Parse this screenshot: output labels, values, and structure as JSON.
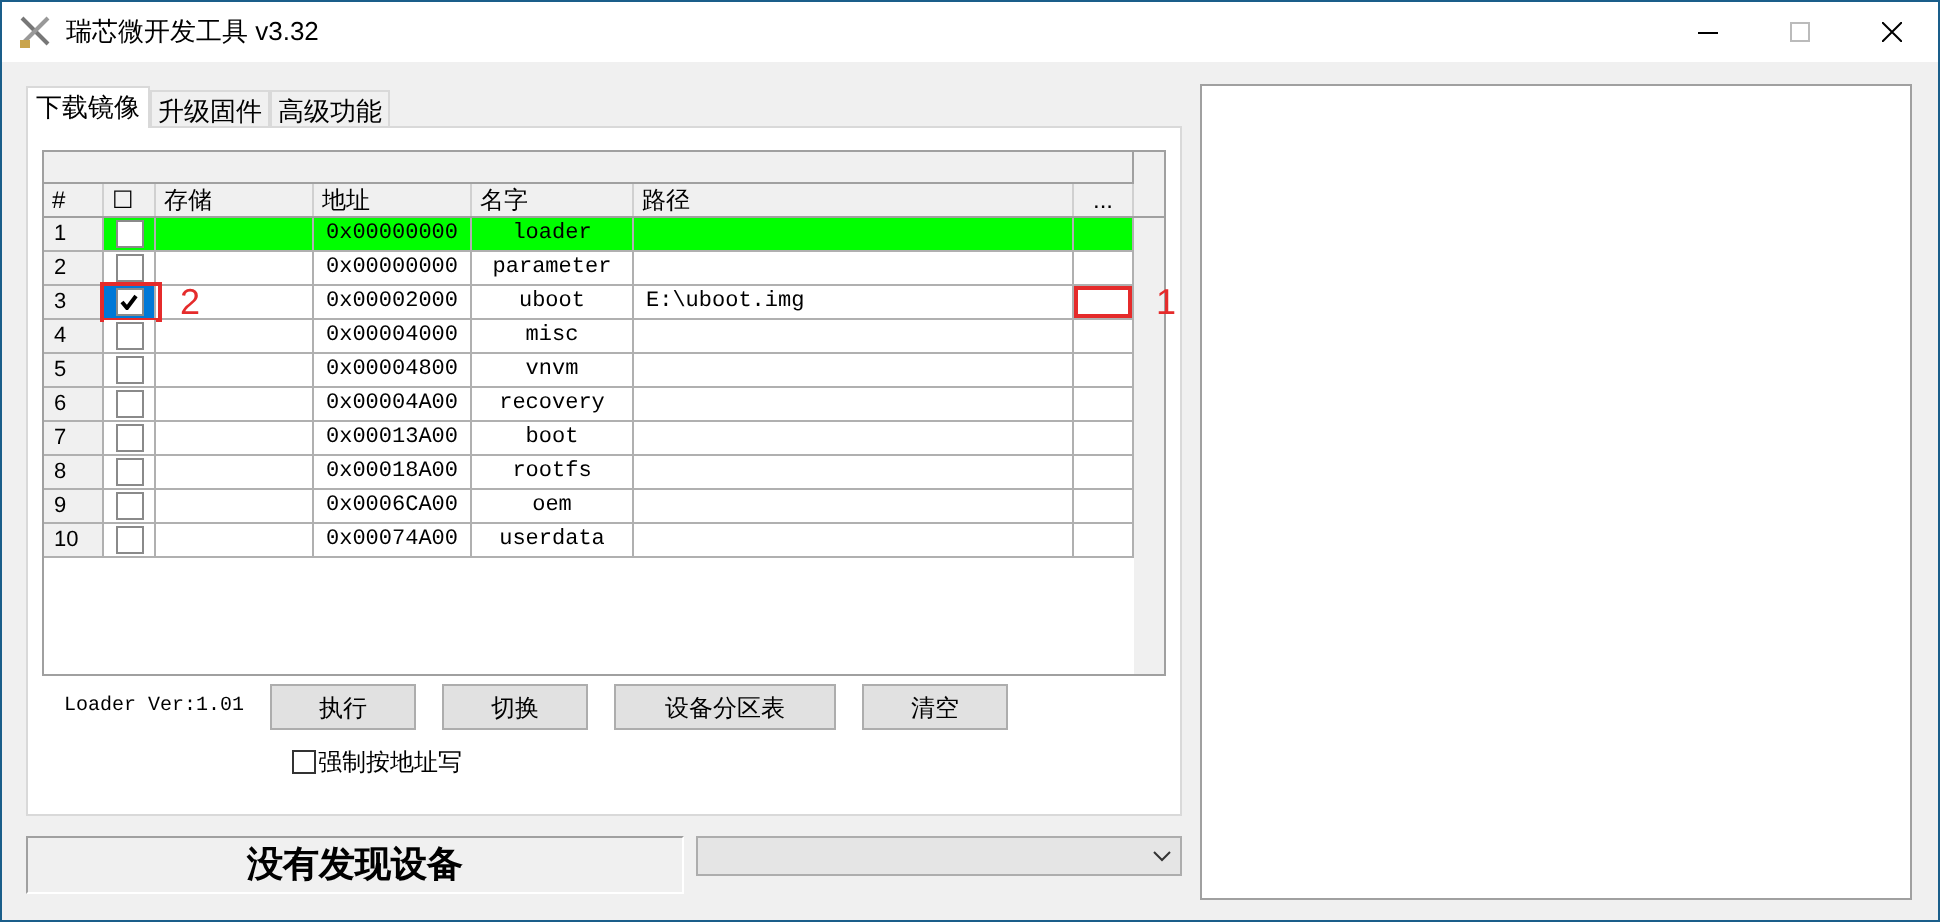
{
  "window": {
    "title": "瑞芯微开发工具 v3.32"
  },
  "tabs": [
    {
      "label": "下载镜像",
      "selected": true
    },
    {
      "label": "升级固件",
      "selected": false
    },
    {
      "label": "高级功能",
      "selected": false
    }
  ],
  "table": {
    "columns": [
      "#",
      "☐",
      "存储",
      "地址",
      "名字",
      "路径",
      "..."
    ],
    "rows": [
      {
        "index": "1",
        "checked": false,
        "selected": false,
        "highlighted": true,
        "address": "0x00000000",
        "name": "loader",
        "path": ""
      },
      {
        "index": "2",
        "checked": false,
        "selected": false,
        "highlighted": false,
        "address": "0x00000000",
        "name": "parameter",
        "path": ""
      },
      {
        "index": "3",
        "checked": true,
        "selected": true,
        "highlighted": false,
        "address": "0x00002000",
        "name": "uboot",
        "path": "E:\\uboot.img",
        "check_marker": "2",
        "browse_marker": "1"
      },
      {
        "index": "4",
        "checked": false,
        "selected": false,
        "highlighted": false,
        "address": "0x00004000",
        "name": "misc",
        "path": ""
      },
      {
        "index": "5",
        "checked": false,
        "selected": false,
        "highlighted": false,
        "address": "0x00004800",
        "name": "vnvm",
        "path": ""
      },
      {
        "index": "6",
        "checked": false,
        "selected": false,
        "highlighted": false,
        "address": "0x00004A00",
        "name": "recovery",
        "path": ""
      },
      {
        "index": "7",
        "checked": false,
        "selected": false,
        "highlighted": false,
        "address": "0x00013A00",
        "name": "boot",
        "path": ""
      },
      {
        "index": "8",
        "checked": false,
        "selected": false,
        "highlighted": false,
        "address": "0x00018A00",
        "name": "rootfs",
        "path": ""
      },
      {
        "index": "9",
        "checked": false,
        "selected": false,
        "highlighted": false,
        "address": "0x0006CA00",
        "name": "oem",
        "path": ""
      },
      {
        "index": "10",
        "checked": false,
        "selected": false,
        "highlighted": false,
        "address": "0x00074A00",
        "name": "userdata",
        "path": ""
      }
    ]
  },
  "loader_version": "Loader Ver:1.01",
  "buttons": [
    "执行",
    "切换",
    "设备分区表",
    "清空"
  ],
  "force_address_write": {
    "label": "强制按地址写",
    "checked": false
  },
  "status": "没有发现设备"
}
